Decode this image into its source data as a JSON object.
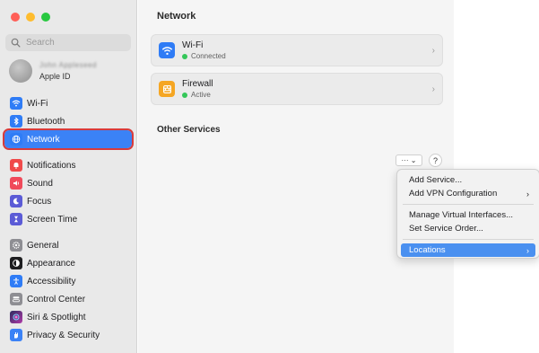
{
  "sidebar": {
    "search_placeholder": "Search",
    "apple_id": {
      "name": "John Appleseed",
      "subtitle": "Apple ID"
    },
    "groups": [
      {
        "items": [
          {
            "label": "Wi-Fi",
            "icon": "wifi-icon",
            "color": "#2f7cf6"
          },
          {
            "label": "Bluetooth",
            "icon": "bluetooth-icon",
            "color": "#2f7cf6"
          },
          {
            "label": "Network",
            "icon": "globe-icon",
            "color": "#2f7cf6",
            "selected": true
          }
        ]
      },
      {
        "items": [
          {
            "label": "Notifications",
            "icon": "bell-icon",
            "color": "#f04a4a"
          },
          {
            "label": "Sound",
            "icon": "speaker-icon",
            "color": "#f04a5a"
          },
          {
            "label": "Focus",
            "icon": "moon-icon",
            "color": "#5b5bd6"
          },
          {
            "label": "Screen Time",
            "icon": "hourglass-icon",
            "color": "#5b5bd6"
          }
        ]
      },
      {
        "items": [
          {
            "label": "General",
            "icon": "gear-icon",
            "color": "#8e8e93"
          },
          {
            "label": "Appearance",
            "icon": "appearance-icon",
            "color": "#1d1d1f"
          },
          {
            "label": "Accessibility",
            "icon": "accessibility-icon",
            "color": "#2f7cf6"
          },
          {
            "label": "Control Center",
            "icon": "control-center-icon",
            "color": "#8e8e93"
          },
          {
            "label": "Siri & Spotlight",
            "icon": "siri-icon",
            "color": "#2b2b5e"
          },
          {
            "label": "Privacy & Security",
            "icon": "hand-icon",
            "color": "#3b82f6"
          }
        ]
      }
    ]
  },
  "main": {
    "title": "Network",
    "cards": [
      {
        "title": "Wi-Fi",
        "status": "Connected",
        "icon": "wifi-icon",
        "color": "#2f7cf6"
      },
      {
        "title": "Firewall",
        "status": "Active",
        "icon": "firewall-icon",
        "color": "#f5a623"
      }
    ],
    "other_services": "Other Services",
    "dots_button": "···  ⌄",
    "help_button": "?"
  },
  "menu": {
    "items": [
      {
        "label": "Add Service...",
        "submenu": false
      },
      {
        "label": "Add VPN Configuration",
        "submenu": true
      },
      {
        "separator": true
      },
      {
        "label": "Manage Virtual Interfaces...",
        "submenu": false
      },
      {
        "label": "Set Service Order...",
        "submenu": false
      },
      {
        "separator": true
      },
      {
        "label": "Locations",
        "submenu": true,
        "highlighted": true
      }
    ]
  },
  "colors": {
    "accent": "#3b82f6",
    "selection_outline": "#d83b3b",
    "status_green": "#34c759"
  }
}
